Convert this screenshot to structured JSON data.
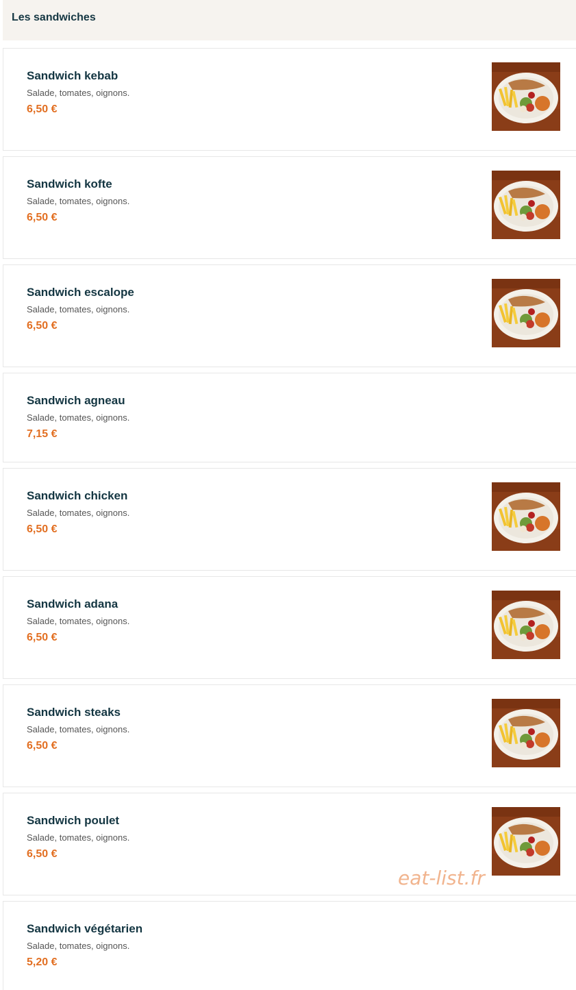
{
  "section": {
    "title": "Les sandwiches"
  },
  "items": [
    {
      "name": "Sandwich kebab",
      "description": "Salade, tomates, oignons.",
      "price": "6,50 €",
      "has_image": true
    },
    {
      "name": "Sandwich kofte",
      "description": "Salade, tomates, oignons.",
      "price": "6,50 €",
      "has_image": true
    },
    {
      "name": "Sandwich escalope",
      "description": "Salade, tomates, oignons.",
      "price": "6,50 €",
      "has_image": true
    },
    {
      "name": "Sandwich agneau",
      "description": "Salade, tomates, oignons.",
      "price": "7,15 €",
      "has_image": false
    },
    {
      "name": "Sandwich chicken",
      "description": "Salade, tomates, oignons.",
      "price": "6,50 €",
      "has_image": true
    },
    {
      "name": "Sandwich adana",
      "description": "Salade, tomates, oignons.",
      "price": "6,50 €",
      "has_image": true
    },
    {
      "name": "Sandwich steaks",
      "description": "Salade, tomates, oignons.",
      "price": "6,50 €",
      "has_image": true
    },
    {
      "name": "Sandwich poulet",
      "description": "Salade, tomates, oignons.",
      "price": "6,50 €",
      "has_image": true
    },
    {
      "name": "Sandwich végétarien",
      "description": "Salade, tomates, oignons.",
      "price": "5,20 €",
      "has_image": false
    }
  ],
  "watermark": "eat-list.fr",
  "colors": {
    "title": "#143642",
    "price": "#e26f22",
    "header_bg": "#f6f3ef",
    "watermark": "#f1b48e"
  }
}
